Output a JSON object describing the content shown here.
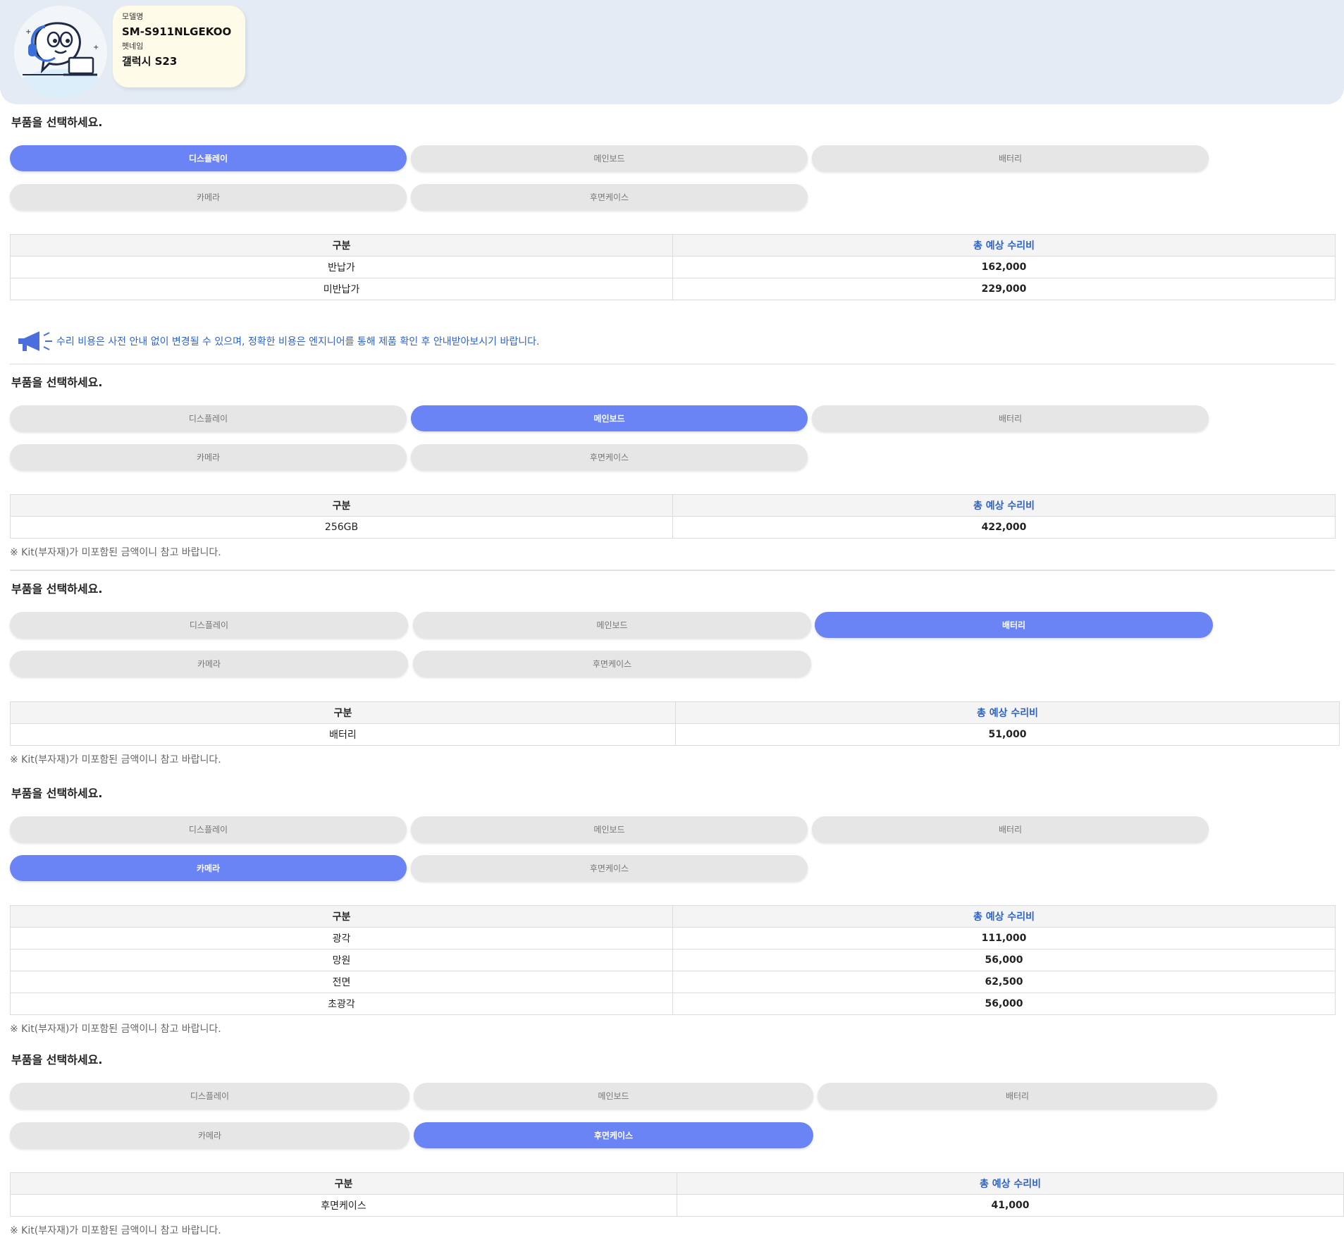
{
  "header": {
    "model_label": "모델명",
    "model_value": "SM-S911NLGEKOO",
    "pet_label": "펫네임",
    "pet_value": "갤럭시 S23"
  },
  "notice": "수리 비용은 사전 안내 없이 변경될 수 있으며, 정확한 비용은 엔지니어를 통해 제품 확인 후 안내받아보시기 바랍니다.",
  "sections": [
    {
      "title": "부품을 선택하세요.",
      "buttons": [
        "디스플레이",
        "메인보드",
        "배터리",
        "카메라",
        "후면케이스"
      ],
      "active": 0,
      "table_headers": [
        "구분",
        "총 예상 수리비"
      ],
      "rows": [
        [
          "반납가",
          "162,000"
        ],
        [
          "미반납가",
          "229,000"
        ]
      ],
      "note": ""
    },
    {
      "title": "부품을 선택하세요.",
      "buttons": [
        "디스플레이",
        "메인보드",
        "배터리",
        "카메라",
        "후면케이스"
      ],
      "active": 1,
      "table_headers": [
        "구분",
        "총 예상 수리비"
      ],
      "rows": [
        [
          "256GB",
          "422,000"
        ]
      ],
      "note": "※ Kit(부자재)가 미포함된 금액이니 참고 바랍니다."
    },
    {
      "title": "부품을 선택하세요.",
      "buttons": [
        "디스플레이",
        "메인보드",
        "배터리",
        "카메라",
        "후면케이스"
      ],
      "active": 2,
      "table_headers": [
        "구분",
        "총 예상 수리비"
      ],
      "rows": [
        [
          "배터리",
          "51,000"
        ]
      ],
      "note": "※ Kit(부자재)가 미포함된 금액이니 참고 바랍니다."
    },
    {
      "title": "부품을 선택하세요.",
      "buttons": [
        "디스플레이",
        "메인보드",
        "배터리",
        "카메라",
        "후면케이스"
      ],
      "active": 3,
      "table_headers": [
        "구분",
        "총 예상 수리비"
      ],
      "rows": [
        [
          "광각",
          "111,000"
        ],
        [
          "망원",
          "56,000"
        ],
        [
          "전면",
          "62,500"
        ],
        [
          "초광각",
          "56,000"
        ]
      ],
      "note": "※ Kit(부자재)가 미포함된 금액이니 참고 바랍니다."
    },
    {
      "title": "부품을 선택하세요.",
      "buttons": [
        "디스플레이",
        "메인보드",
        "배터리",
        "카메라",
        "후면케이스"
      ],
      "active": 4,
      "table_headers": [
        "구분",
        "총 예상 수리비"
      ],
      "rows": [
        [
          "후면케이스",
          "41,000"
        ]
      ],
      "note": "※ Kit(부자재)가 미포함된 금액이니 참고 바랍니다."
    }
  ],
  "colors": {
    "active_button": "#6b84f5",
    "inactive_button": "#e6e6e6",
    "header_bg": "#e4ebf4",
    "accent_text": "#2f63c9"
  }
}
